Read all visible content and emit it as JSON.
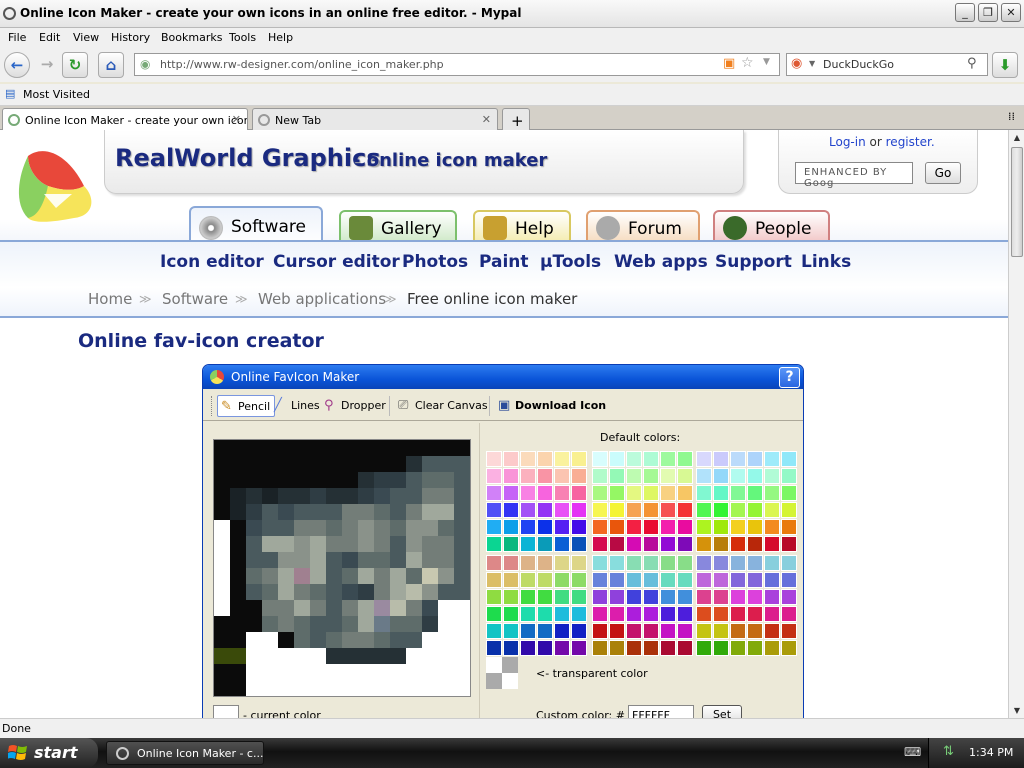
{
  "window": {
    "title": "Online Icon Maker - create your own icons in an online free editor. - Mypal"
  },
  "menu": [
    "File",
    "Edit",
    "View",
    "History",
    "Bookmarks",
    "Tools",
    "Help"
  ],
  "nav": {
    "url": "http://www.rw-designer.com/online_icon_maker.php",
    "search_engine": "DuckDuckGo"
  },
  "bookmarks": {
    "most_visited": "Most Visited"
  },
  "tabs": [
    {
      "label": "Online Icon Maker - create your own icon...",
      "active": true
    },
    {
      "label": "New Tab",
      "active": false
    }
  ],
  "site": {
    "brand": "RealWorld Graphics",
    "tagline": "- online icon maker",
    "login": "Log-in",
    "or": "or",
    "register": "register.",
    "search_placeholder": "ENHANCED BY Goog",
    "go": "Go",
    "main_tabs": [
      "Software",
      "Gallery",
      "Help",
      "Forum",
      "People"
    ],
    "subnav": [
      "Icon editor",
      "Cursor editor",
      "Photos",
      "Paint",
      "µTools",
      "Web apps",
      "Support",
      "Links"
    ],
    "breadcrumb": [
      "Home",
      "Software",
      "Web applications",
      "Free online icon maker"
    ],
    "heading": "Online fav-icon creator"
  },
  "maker": {
    "title": "Online FavIcon Maker",
    "help": "?",
    "tools": [
      "Pencil",
      "Lines",
      "Dropper",
      "Clear Canvas",
      "Download Icon"
    ],
    "default_colors": "Default colors:",
    "transparent": "<- transparent color",
    "current_color": "- current color",
    "custom_color": "Custom color: #",
    "custom_value": "FFFFFF",
    "set": "Set"
  },
  "pixels": [
    "0000000000000000",
    "0000000000002555",
    "0000000002335665",
    "0121223223455775",
    "0135455577657995",
    "F045577678768865",
    "F059989778758775",
    "F055889546659775",
    "F0679b9569796B85",
    "F05697654379A855",
    "F007797579cA74FF",
    "0006765569D663FF",
    "00FF065677655FFF",
    "hhFFFFF22222FFFF",
    "00FFFFFFFFFFFFFF",
    "00FFFFFFFFFFFFFF"
  ],
  "status": "Done",
  "taskbar": {
    "start": "start",
    "task": "Online Icon Maker - c...",
    "clock": "1:34 PM"
  }
}
